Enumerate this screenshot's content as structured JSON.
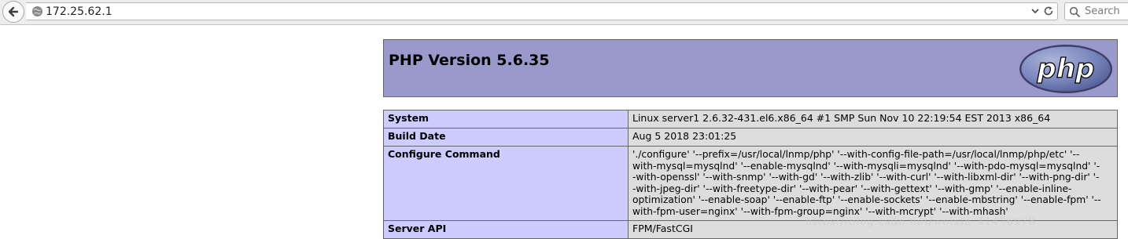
{
  "browser": {
    "url": "172.25.62.1",
    "search_placeholder": "Search"
  },
  "php": {
    "title": "PHP Version 5.6.35",
    "logo_text": "php",
    "logo_color": "#6c7eb7"
  },
  "info_rows": [
    {
      "label": "System",
      "value": "Linux server1 2.6.32-431.el6.x86_64 #1 SMP Sun Nov 10 22:19:54 EST 2013 x86_64"
    },
    {
      "label": "Build Date",
      "value": "Aug 5 2018 23:01:25"
    },
    {
      "label": "Configure Command",
      "value": "'./configure' '--prefix=/usr/local/lnmp/php' '--with-config-file-path=/usr/local/lnmp/php/etc' '--with-mysql=mysqlnd' '--enable-mysqlnd' '--with-mysqli=mysqlnd' '--with-pdo-mysql=mysqlnd' '--with-openssl' '--with-snmp' '--with-gd' '--with-zlib' '--with-curl' '--with-libxml-dir' '--with-png-dir' '--with-jpeg-dir' '--with-freetype-dir' '--with-pear' '--with-gettext' '--with-gmp' '--enable-inline-optimization' '--enable-soap' '--enable-ftp' '--enable-sockets' '--enable-mbstring' '--enable-fpm' '--with-fpm-user=nginx' '--with-fpm-group=nginx' '--with-mcrypt' '--with-mhash'"
    },
    {
      "label": "Server API",
      "value": "FPM/FastCGI"
    }
  ],
  "watermark": "https://blog.csdn.net/weixin_41476978"
}
